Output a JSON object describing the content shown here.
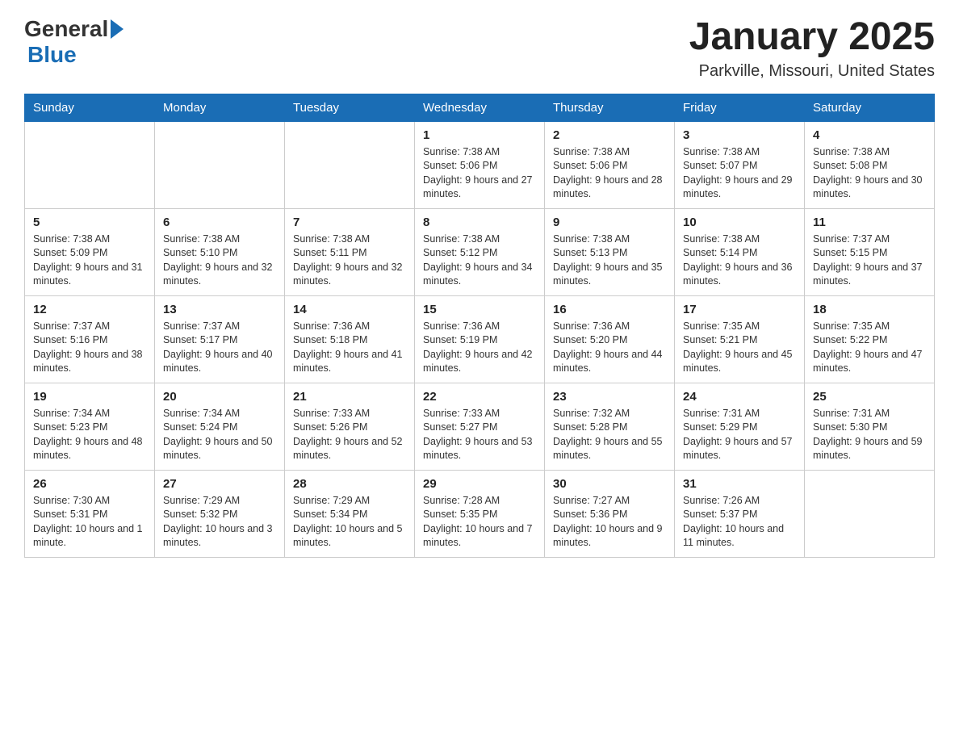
{
  "header": {
    "logo_general": "General",
    "logo_blue": "Blue",
    "month_title": "January 2025",
    "location": "Parkville, Missouri, United States"
  },
  "days_of_week": [
    "Sunday",
    "Monday",
    "Tuesday",
    "Wednesday",
    "Thursday",
    "Friday",
    "Saturday"
  ],
  "weeks": [
    [
      {
        "day": "",
        "info": ""
      },
      {
        "day": "",
        "info": ""
      },
      {
        "day": "",
        "info": ""
      },
      {
        "day": "1",
        "info": "Sunrise: 7:38 AM\nSunset: 5:06 PM\nDaylight: 9 hours and 27 minutes."
      },
      {
        "day": "2",
        "info": "Sunrise: 7:38 AM\nSunset: 5:06 PM\nDaylight: 9 hours and 28 minutes."
      },
      {
        "day": "3",
        "info": "Sunrise: 7:38 AM\nSunset: 5:07 PM\nDaylight: 9 hours and 29 minutes."
      },
      {
        "day": "4",
        "info": "Sunrise: 7:38 AM\nSunset: 5:08 PM\nDaylight: 9 hours and 30 minutes."
      }
    ],
    [
      {
        "day": "5",
        "info": "Sunrise: 7:38 AM\nSunset: 5:09 PM\nDaylight: 9 hours and 31 minutes."
      },
      {
        "day": "6",
        "info": "Sunrise: 7:38 AM\nSunset: 5:10 PM\nDaylight: 9 hours and 32 minutes."
      },
      {
        "day": "7",
        "info": "Sunrise: 7:38 AM\nSunset: 5:11 PM\nDaylight: 9 hours and 32 minutes."
      },
      {
        "day": "8",
        "info": "Sunrise: 7:38 AM\nSunset: 5:12 PM\nDaylight: 9 hours and 34 minutes."
      },
      {
        "day": "9",
        "info": "Sunrise: 7:38 AM\nSunset: 5:13 PM\nDaylight: 9 hours and 35 minutes."
      },
      {
        "day": "10",
        "info": "Sunrise: 7:38 AM\nSunset: 5:14 PM\nDaylight: 9 hours and 36 minutes."
      },
      {
        "day": "11",
        "info": "Sunrise: 7:37 AM\nSunset: 5:15 PM\nDaylight: 9 hours and 37 minutes."
      }
    ],
    [
      {
        "day": "12",
        "info": "Sunrise: 7:37 AM\nSunset: 5:16 PM\nDaylight: 9 hours and 38 minutes."
      },
      {
        "day": "13",
        "info": "Sunrise: 7:37 AM\nSunset: 5:17 PM\nDaylight: 9 hours and 40 minutes."
      },
      {
        "day": "14",
        "info": "Sunrise: 7:36 AM\nSunset: 5:18 PM\nDaylight: 9 hours and 41 minutes."
      },
      {
        "day": "15",
        "info": "Sunrise: 7:36 AM\nSunset: 5:19 PM\nDaylight: 9 hours and 42 minutes."
      },
      {
        "day": "16",
        "info": "Sunrise: 7:36 AM\nSunset: 5:20 PM\nDaylight: 9 hours and 44 minutes."
      },
      {
        "day": "17",
        "info": "Sunrise: 7:35 AM\nSunset: 5:21 PM\nDaylight: 9 hours and 45 minutes."
      },
      {
        "day": "18",
        "info": "Sunrise: 7:35 AM\nSunset: 5:22 PM\nDaylight: 9 hours and 47 minutes."
      }
    ],
    [
      {
        "day": "19",
        "info": "Sunrise: 7:34 AM\nSunset: 5:23 PM\nDaylight: 9 hours and 48 minutes."
      },
      {
        "day": "20",
        "info": "Sunrise: 7:34 AM\nSunset: 5:24 PM\nDaylight: 9 hours and 50 minutes."
      },
      {
        "day": "21",
        "info": "Sunrise: 7:33 AM\nSunset: 5:26 PM\nDaylight: 9 hours and 52 minutes."
      },
      {
        "day": "22",
        "info": "Sunrise: 7:33 AM\nSunset: 5:27 PM\nDaylight: 9 hours and 53 minutes."
      },
      {
        "day": "23",
        "info": "Sunrise: 7:32 AM\nSunset: 5:28 PM\nDaylight: 9 hours and 55 minutes."
      },
      {
        "day": "24",
        "info": "Sunrise: 7:31 AM\nSunset: 5:29 PM\nDaylight: 9 hours and 57 minutes."
      },
      {
        "day": "25",
        "info": "Sunrise: 7:31 AM\nSunset: 5:30 PM\nDaylight: 9 hours and 59 minutes."
      }
    ],
    [
      {
        "day": "26",
        "info": "Sunrise: 7:30 AM\nSunset: 5:31 PM\nDaylight: 10 hours and 1 minute."
      },
      {
        "day": "27",
        "info": "Sunrise: 7:29 AM\nSunset: 5:32 PM\nDaylight: 10 hours and 3 minutes."
      },
      {
        "day": "28",
        "info": "Sunrise: 7:29 AM\nSunset: 5:34 PM\nDaylight: 10 hours and 5 minutes."
      },
      {
        "day": "29",
        "info": "Sunrise: 7:28 AM\nSunset: 5:35 PM\nDaylight: 10 hours and 7 minutes."
      },
      {
        "day": "30",
        "info": "Sunrise: 7:27 AM\nSunset: 5:36 PM\nDaylight: 10 hours and 9 minutes."
      },
      {
        "day": "31",
        "info": "Sunrise: 7:26 AM\nSunset: 5:37 PM\nDaylight: 10 hours and 11 minutes."
      },
      {
        "day": "",
        "info": ""
      }
    ]
  ]
}
